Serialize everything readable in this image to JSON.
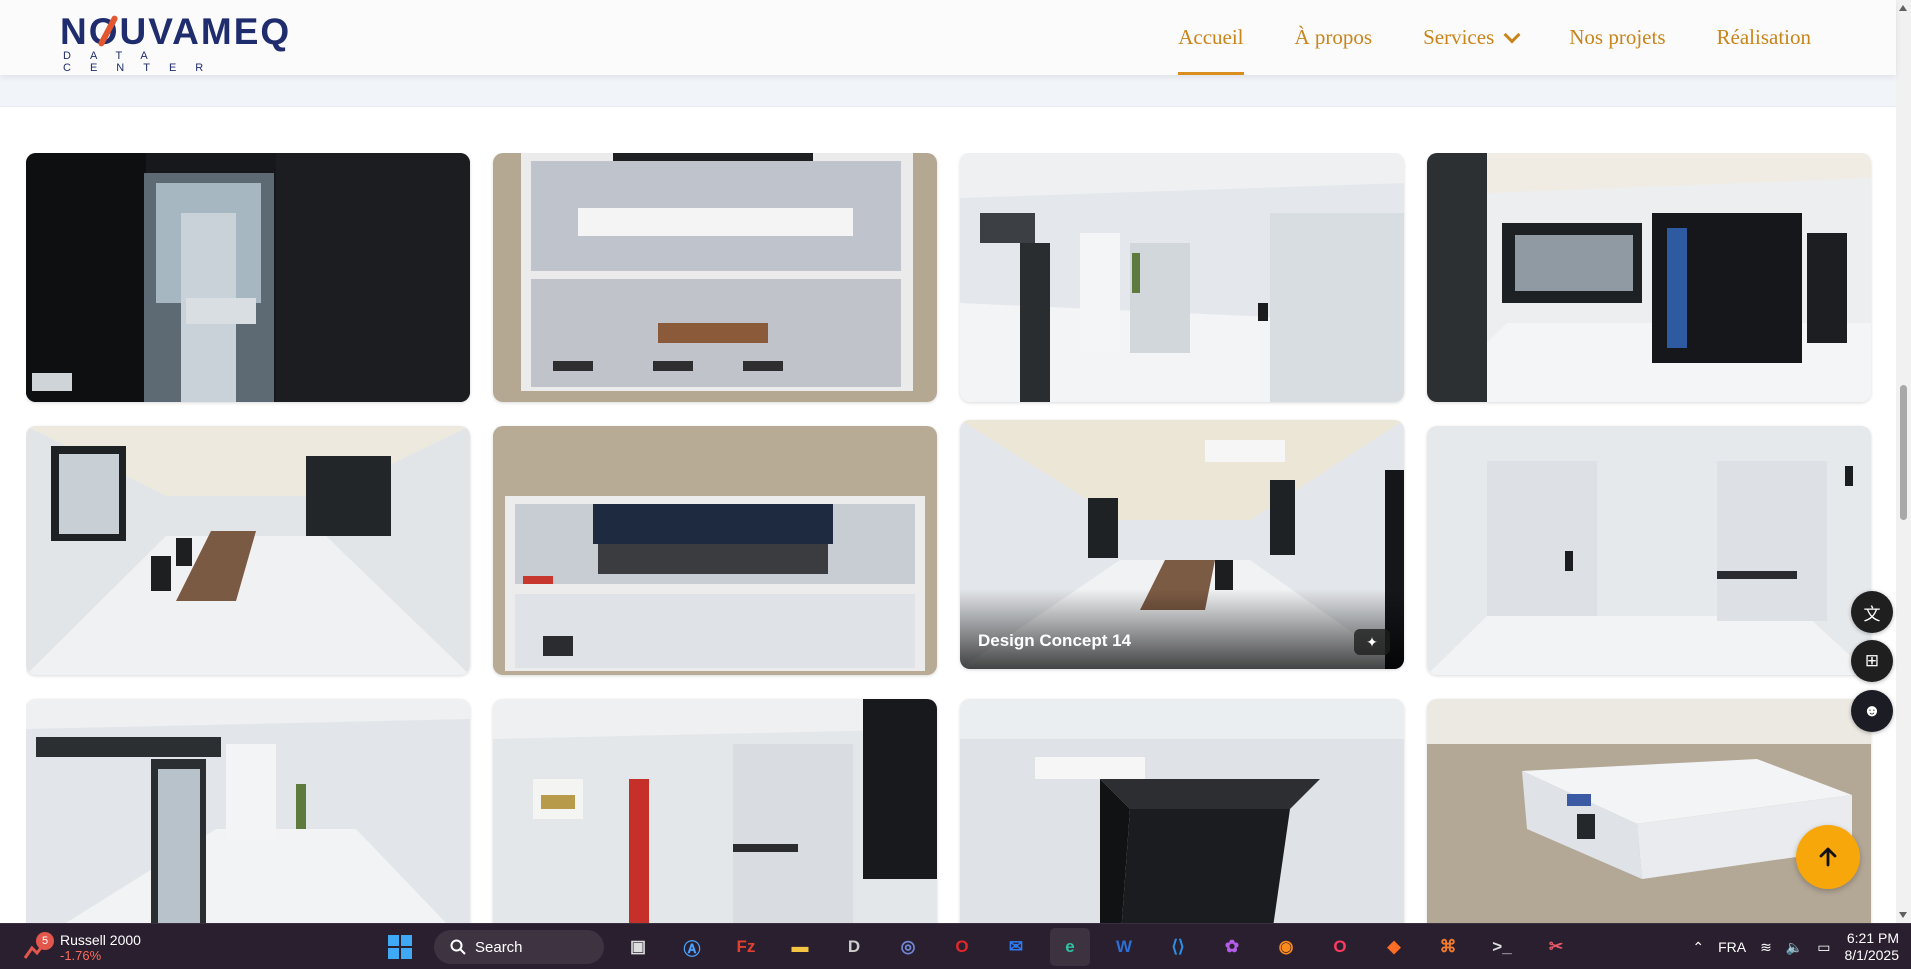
{
  "brand": {
    "name": "NOUVAMEQ",
    "tagline": "DATA CENTER"
  },
  "nav": {
    "items": [
      {
        "label": "Accueil",
        "active": true
      },
      {
        "label": "À propos",
        "active": false
      },
      {
        "label": "Services",
        "active": false,
        "dropdown": true
      },
      {
        "label": "Nos projets",
        "active": false
      },
      {
        "label": "Réalisation",
        "active": false
      }
    ]
  },
  "gallery": {
    "hovered_title": "Design Concept 14",
    "tiles": [
      "server-room-glass-door",
      "container-top-view-meeting",
      "white-corridor-doors",
      "server-rack-room",
      "meeting-room-long-table",
      "container-top-view-racks",
      "meeting-room-hovered",
      "white-room-doors",
      "corridor-glass-door-plant",
      "fire-extinguisher-room",
      "black-rack-cabinet",
      "container-exterior"
    ]
  },
  "colors": {
    "accent": "#c9841a",
    "brand_navy": "#1f2d6e",
    "brand_orange": "#e2572f",
    "to_top": "#f8a70b"
  },
  "taskbar": {
    "ticker_badge": "5",
    "ticker_name": "Russell 2000",
    "ticker_change": "-1.76%",
    "search_label": "Search",
    "language": "FRA",
    "time": "6:21 PM",
    "date": "8/1/2025"
  }
}
